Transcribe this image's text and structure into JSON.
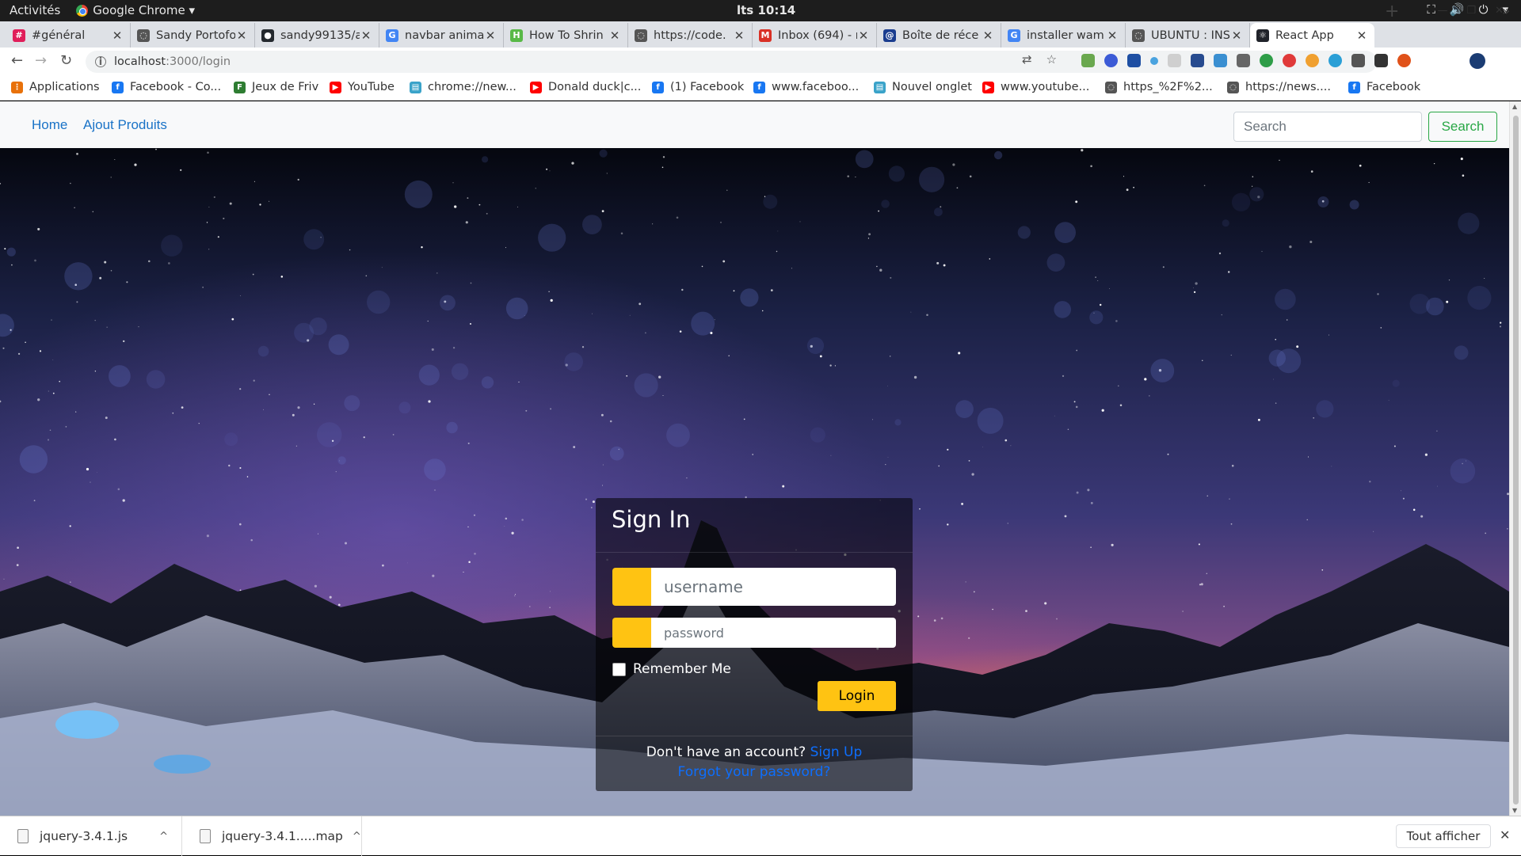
{
  "os_bar": {
    "activities": "Activités",
    "app_menu": "Google Chrome",
    "clock": "lts 10:14"
  },
  "browser": {
    "tabs": [
      {
        "title": "#général",
        "icon": "slack-icon",
        "color": "#e01e5a"
      },
      {
        "title": "Sandy Portofo",
        "icon": "web-icon",
        "color": "#555555"
      },
      {
        "title": "sandy99135/a",
        "icon": "github-icon",
        "color": "#24292e"
      },
      {
        "title": "navbar anima",
        "icon": "google-icon",
        "color": "#4285f4"
      },
      {
        "title": "How To Shrin",
        "icon": "howto-icon",
        "color": "#58b947"
      },
      {
        "title": "https://code.",
        "icon": "web-icon",
        "color": "#555555"
      },
      {
        "title": "Inbox (694) - r",
        "icon": "gmail-icon",
        "color": "#d93025"
      },
      {
        "title": "Boîte de réce",
        "icon": "mail-icon",
        "color": "#1a3d8f"
      },
      {
        "title": "installer wam",
        "icon": "google-icon",
        "color": "#4285f4"
      },
      {
        "title": "UBUNTU : INS",
        "icon": "web-icon",
        "color": "#555555"
      },
      {
        "title": "React App",
        "icon": "react-icon",
        "color": "#20232a",
        "active": true
      }
    ],
    "url_host": "localhost",
    "url_path": ":3000/login",
    "bookmarks": [
      {
        "label": "Applications",
        "icon": "apps-grid-icon",
        "color": "#e8710a"
      },
      {
        "label": "Facebook - Co...",
        "icon": "facebook-icon",
        "color": "#1877f2"
      },
      {
        "label": "Jeux de Friv",
        "icon": "friv-icon",
        "color": "#2e7d32"
      },
      {
        "label": "YouTube",
        "icon": "youtube-icon",
        "color": "#ff0000"
      },
      {
        "label": "chrome://new...",
        "icon": "page-icon",
        "color": "#3aa3c9"
      },
      {
        "label": "Donald duck|c...",
        "icon": "youtube-icon",
        "color": "#ff0000"
      },
      {
        "label": "(1) Facebook",
        "icon": "facebook-icon",
        "color": "#1877f2"
      },
      {
        "label": "www.faceboo...",
        "icon": "facebook-icon",
        "color": "#1877f2"
      },
      {
        "label": "Nouvel onglet",
        "icon": "page-icon",
        "color": "#3aa3c9"
      },
      {
        "label": "www.youtube...",
        "icon": "youtube-icon",
        "color": "#ff0000"
      },
      {
        "label": "https_%2F%2...",
        "icon": "web-icon",
        "color": "#555555"
      },
      {
        "label": "https://news....",
        "icon": "web-icon",
        "color": "#555555"
      },
      {
        "label": "Facebook",
        "icon": "facebook-icon",
        "color": "#1877f2"
      }
    ]
  },
  "app": {
    "nav_links": [
      "Home",
      "Ajout Produits"
    ],
    "search_placeholder": "Search",
    "search_button": "Search",
    "signin": {
      "title": "Sign In",
      "username_placeholder": "username",
      "password_placeholder": "password",
      "remember_label": "Remember Me",
      "login_button": "Login",
      "no_account_text": "Don't have an account?",
      "signup_link": "Sign Up",
      "forgot_link": "Forgot your password?"
    }
  },
  "downloads": {
    "items": [
      "jquery-3.4.1.js",
      "jquery-3.4.1.....map"
    ],
    "show_all": "Tout afficher"
  },
  "colors": {
    "accent_yellow": "#ffc312",
    "link_blue": "#1a73c7",
    "search_green": "#28a745"
  }
}
